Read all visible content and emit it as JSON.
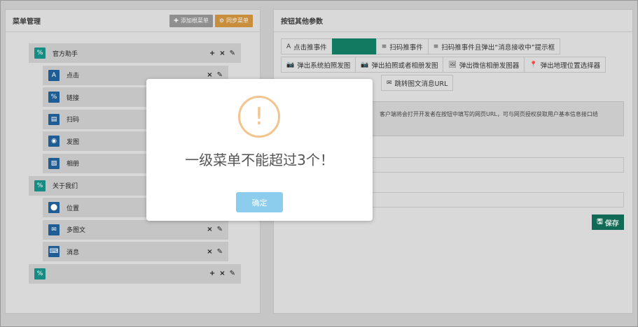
{
  "left_panel": {
    "title": "菜单管理",
    "add_button": "添加根菜单",
    "sync_button": "同步菜单"
  },
  "menu": [
    {
      "level": "top",
      "icon": "link-icon",
      "label": "官方助手",
      "actions": [
        "+",
        "×",
        "✎"
      ]
    },
    {
      "level": "child",
      "icon": "text-icon",
      "label": "点击",
      "actions": [
        "×",
        "✎"
      ]
    },
    {
      "level": "child",
      "icon": "link-icon",
      "label": "链接",
      "actions": []
    },
    {
      "level": "child",
      "icon": "barcode-icon",
      "label": "扫码",
      "actions": []
    },
    {
      "level": "child",
      "icon": "camera-icon",
      "label": "发图",
      "actions": []
    },
    {
      "level": "child",
      "icon": "image-icon",
      "label": "相册",
      "actions": []
    },
    {
      "level": "top",
      "icon": "link-icon",
      "label": "关于我们",
      "actions": []
    },
    {
      "level": "child",
      "icon": "map-marker-icon",
      "label": "位置",
      "actions": []
    },
    {
      "level": "child",
      "icon": "envelope-icon",
      "label": "多图文",
      "actions": [
        "×",
        "✎"
      ]
    },
    {
      "level": "child",
      "icon": "keyboard-icon",
      "label": "消息",
      "actions": [
        "×",
        "✎"
      ]
    },
    {
      "level": "top",
      "icon": "link-icon",
      "label": "",
      "actions": [
        "+",
        "×",
        "✎"
      ]
    }
  ],
  "right_panel": {
    "title": "按钮其他参数",
    "tabs_row1": [
      {
        "icon": "A",
        "label": "点击推事件"
      },
      {
        "icon": "",
        "label": "",
        "active": true
      },
      {
        "icon": "≡",
        "label": "扫码推事件"
      },
      {
        "icon": "≡",
        "label": "扫码推事件且弹出“消息接收中”提示框"
      }
    ],
    "tabs_row2": [
      {
        "icon": "📷",
        "label": "弹出系统拍照发图"
      },
      {
        "icon": "📷",
        "label": "弹出拍照或者相册发图"
      },
      {
        "icon": "🖼",
        "label": "弹出微信相册发图器"
      },
      {
        "icon": "📍",
        "label": "弹出地理位置选择器"
      }
    ],
    "tabs_row3": [
      {
        "icon": "✉",
        "label": "跳转图文消息URL"
      }
    ],
    "description": "客户端将会打开开发者在按钮中填写的网页URL，可与网页授权获取用户基本信息接口结",
    "save_label": "保存"
  },
  "dialog": {
    "message": "一级菜单不能超过3个！",
    "ok_label": "确定",
    "icon": "warning-exclamation-icon"
  }
}
